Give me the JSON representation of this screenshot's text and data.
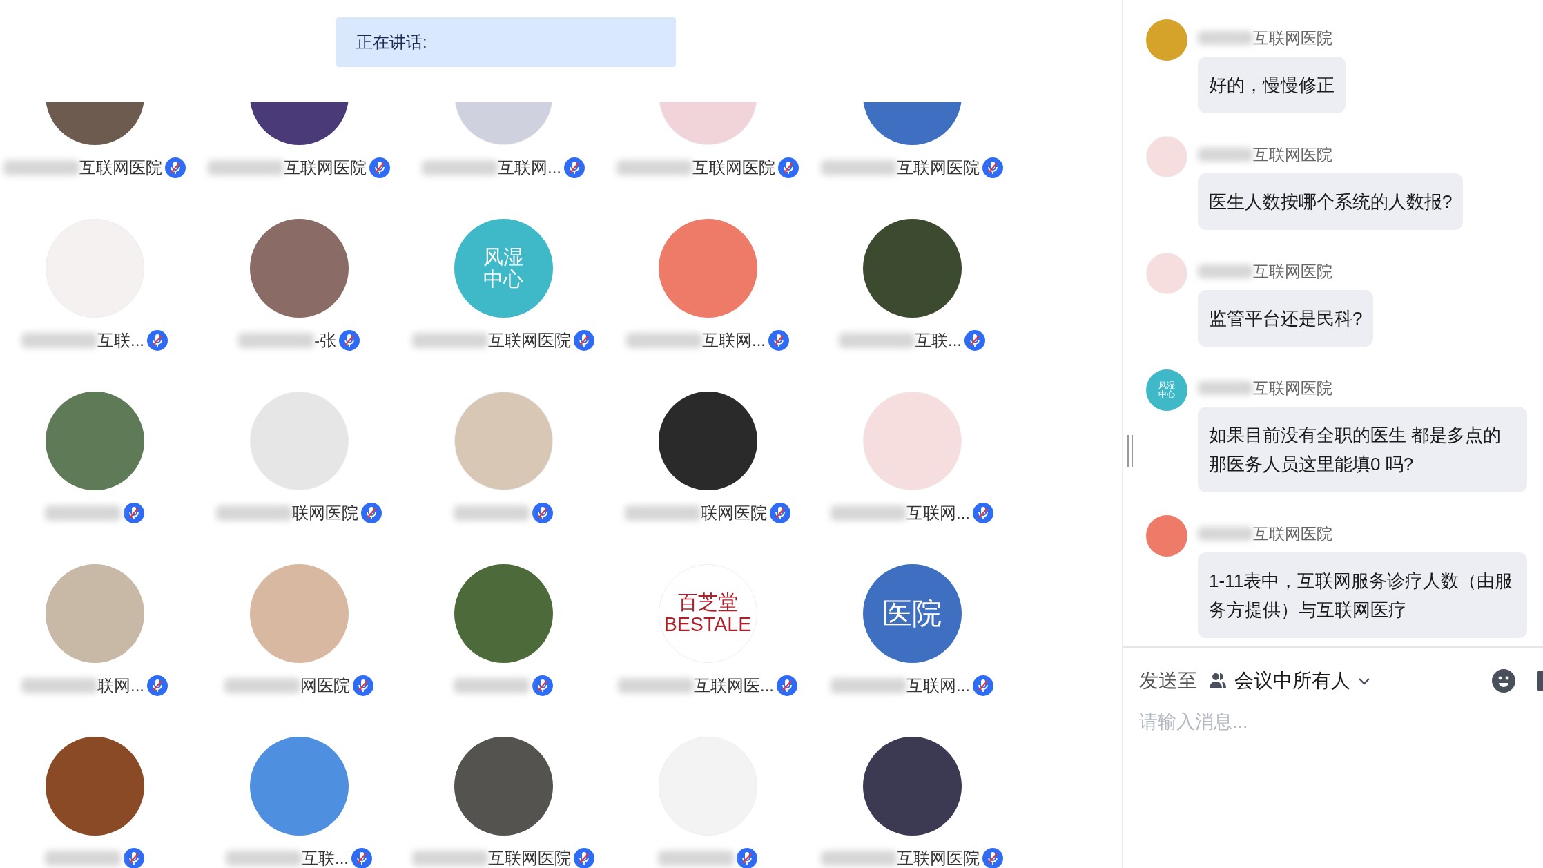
{
  "speaking_bar": {
    "label": "正在讲话:"
  },
  "participants": [
    {
      "name": "互联网医院",
      "muted": true,
      "avatar": {
        "kind": "photo",
        "color": "#6e5b50"
      }
    },
    {
      "name": "互联网医院",
      "muted": true,
      "avatar": {
        "kind": "photo",
        "color": "#4b3a78"
      }
    },
    {
      "name": "互联网...",
      "muted": true,
      "avatar": {
        "kind": "photo",
        "color": "#cfd2de"
      }
    },
    {
      "name": "互联网医院",
      "muted": true,
      "avatar": {
        "kind": "photo",
        "color": "#f1d3da"
      }
    },
    {
      "name": "互联网医院",
      "muted": true,
      "avatar": {
        "kind": "photo",
        "color": "#3e6fc0"
      }
    },
    {
      "name": "互联...",
      "muted": true,
      "avatar": {
        "kind": "photo",
        "color": "#f4f1f0"
      }
    },
    {
      "name": "-张",
      "muted": true,
      "avatar": {
        "kind": "photo",
        "color": "#8a6b66"
      }
    },
    {
      "name": "互联网医院",
      "muted": true,
      "avatar": {
        "kind": "logo",
        "color": "#3fb8c8",
        "text": [
          "风湿",
          "中心"
        ]
      }
    },
    {
      "name": "互联网...",
      "muted": true,
      "avatar": {
        "kind": "photo",
        "color": "#ee7a68"
      }
    },
    {
      "name": "互联...",
      "muted": true,
      "avatar": {
        "kind": "photo",
        "color": "#3c4a30"
      }
    },
    {
      "muted": true,
      "avatar": {
        "kind": "photo",
        "color": "#5f7a56"
      }
    },
    {
      "name": "联网医院",
      "muted": true,
      "avatar": {
        "kind": "photo",
        "color": "#e6e6e6"
      }
    },
    {
      "muted": true,
      "avatar": {
        "kind": "photo",
        "color": "#d8c7b4"
      }
    },
    {
      "name": "联网医院",
      "muted": true,
      "avatar": {
        "kind": "photo",
        "color": "#2a2a2a"
      }
    },
    {
      "name": "互联网...",
      "muted": true,
      "avatar": {
        "kind": "photo",
        "color": "#f6dede"
      }
    },
    {
      "name": "联网...",
      "muted": true,
      "avatar": {
        "kind": "photo",
        "color": "#c8b8a6"
      }
    },
    {
      "name": "网医院",
      "muted": true,
      "avatar": {
        "kind": "photo",
        "color": "#d9b8a2"
      }
    },
    {
      "muted": true,
      "avatar": {
        "kind": "photo",
        "color": "#4d6a3a"
      }
    },
    {
      "name": "互联网医...",
      "muted": true,
      "avatar": {
        "kind": "logo",
        "color": "#ffffff",
        "text": [
          "百芝堂",
          "BESTALE"
        ]
      }
    },
    {
      "name": "互联网...",
      "muted": true,
      "avatar": {
        "kind": "logo",
        "color": "#3e6fc0",
        "text": [
          "医院"
        ]
      }
    },
    {
      "muted": true,
      "avatar": {
        "kind": "photo",
        "color": "#8a4a26"
      }
    },
    {
      "name": "互联...",
      "muted": true,
      "avatar": {
        "kind": "photo",
        "color": "#4f8fe0"
      }
    },
    {
      "name": "互联网医院",
      "muted": true,
      "avatar": {
        "kind": "photo",
        "color": "#55534f"
      }
    },
    {
      "muted": true,
      "avatar": {
        "kind": "photo",
        "color": "#f3f3f3"
      }
    },
    {
      "name": "互联网医院",
      "muted": true,
      "avatar": {
        "kind": "photo",
        "color": "#3c3a52"
      }
    }
  ],
  "chat": {
    "messages": [
      {
        "sender": "互联网医院",
        "text": "好的，慢慢修正",
        "avatar": {
          "kind": "photo",
          "color": "#d6a32a"
        }
      },
      {
        "sender": "互联网医院",
        "text": "医生人数按哪个系统的人数报?",
        "avatar": {
          "kind": "photo",
          "color": "#f6dede"
        }
      },
      {
        "sender": "互联网医院",
        "text": "监管平台还是民科?",
        "avatar": {
          "kind": "photo",
          "color": "#f6dede"
        }
      },
      {
        "sender": "互联网医院",
        "text": "如果目前没有全职的医生 都是多点的那医务人员这里能填0 吗?",
        "avatar": {
          "kind": "logo",
          "color": "#3fb8c8",
          "text": [
            "风湿",
            "中心"
          ]
        }
      },
      {
        "sender": "互联网医院",
        "text": "1-11表中，互联网服务诊疗人数（由服务方提供）与互联网医疗",
        "avatar": {
          "kind": "photo",
          "color": "#ee7a68"
        }
      }
    ],
    "composer": {
      "send_to_label": "发送至",
      "recipient": "会议中所有人",
      "placeholder": "请输入消息..."
    }
  }
}
